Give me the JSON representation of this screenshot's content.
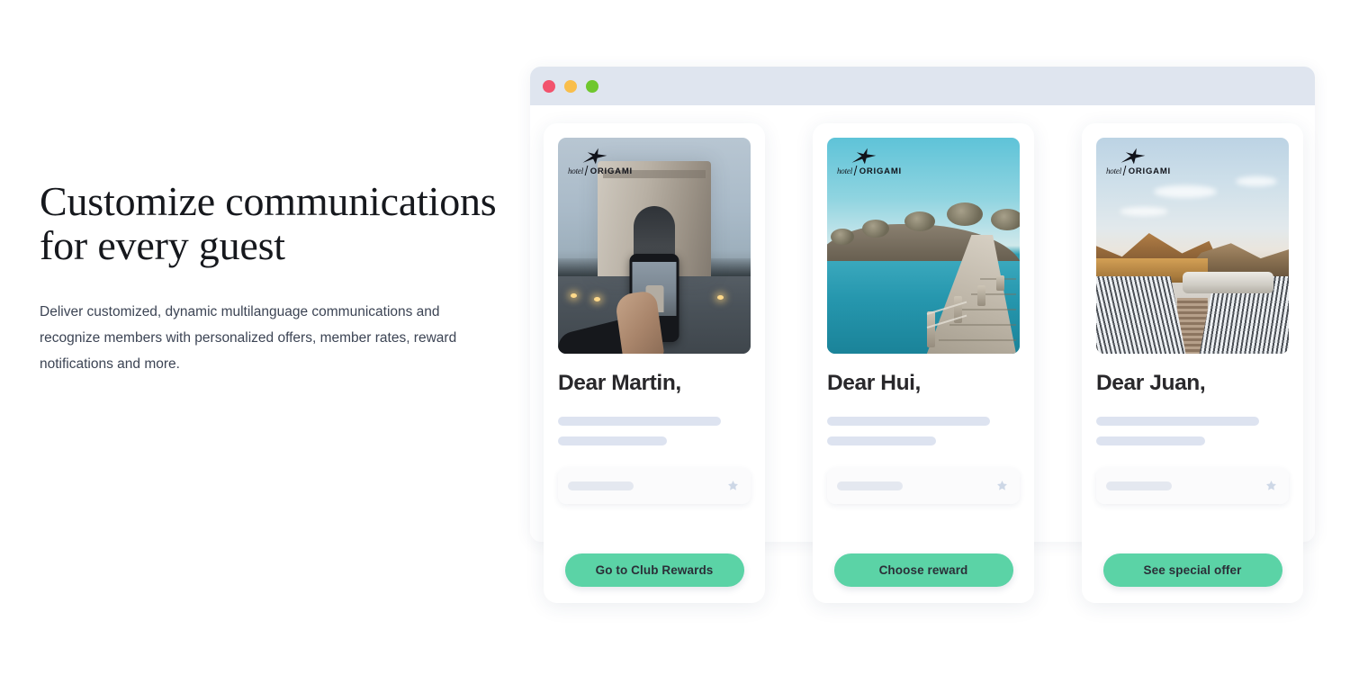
{
  "hero": {
    "headline": "Customize communications for every guest",
    "subcopy": "Deliver customized, dynamic multilanguage communications and recognize members with personalized offers, member rates, reward notifications and more."
  },
  "browser": {
    "traffic_lights": [
      {
        "name": "close-dot",
        "color": "#F2536D"
      },
      {
        "name": "minimize-dot",
        "color": "#F9BE4B"
      },
      {
        "name": "maximize-dot",
        "color": "#6FC72E"
      }
    ],
    "chrome_color": "#dfe5ef"
  },
  "brand": {
    "hotel_word": "hotel",
    "origami_word": "ORIGAMI",
    "logo_icon": "origami-crane-icon"
  },
  "accent_color": "#5bd3a6",
  "cards": [
    {
      "greeting": "Dear Martin,",
      "image_alt": "Arc de Triomphe in Paris photographed on a phone held by a hand",
      "cta_label": "Go to Club Rewards",
      "reward_icon": "star-icon"
    },
    {
      "greeting": "Dear Hui,",
      "image_alt": "Wooden pier over turquoise sea leading to a rocky pine-covered island",
      "cta_label": "Choose reward",
      "reward_icon": "star-icon"
    },
    {
      "greeting": "Dear Juan,",
      "image_alt": "Striped sun loungers with rolled towels facing golden mountains at sunset",
      "cta_label": "See special offer",
      "reward_icon": "star-icon"
    }
  ]
}
